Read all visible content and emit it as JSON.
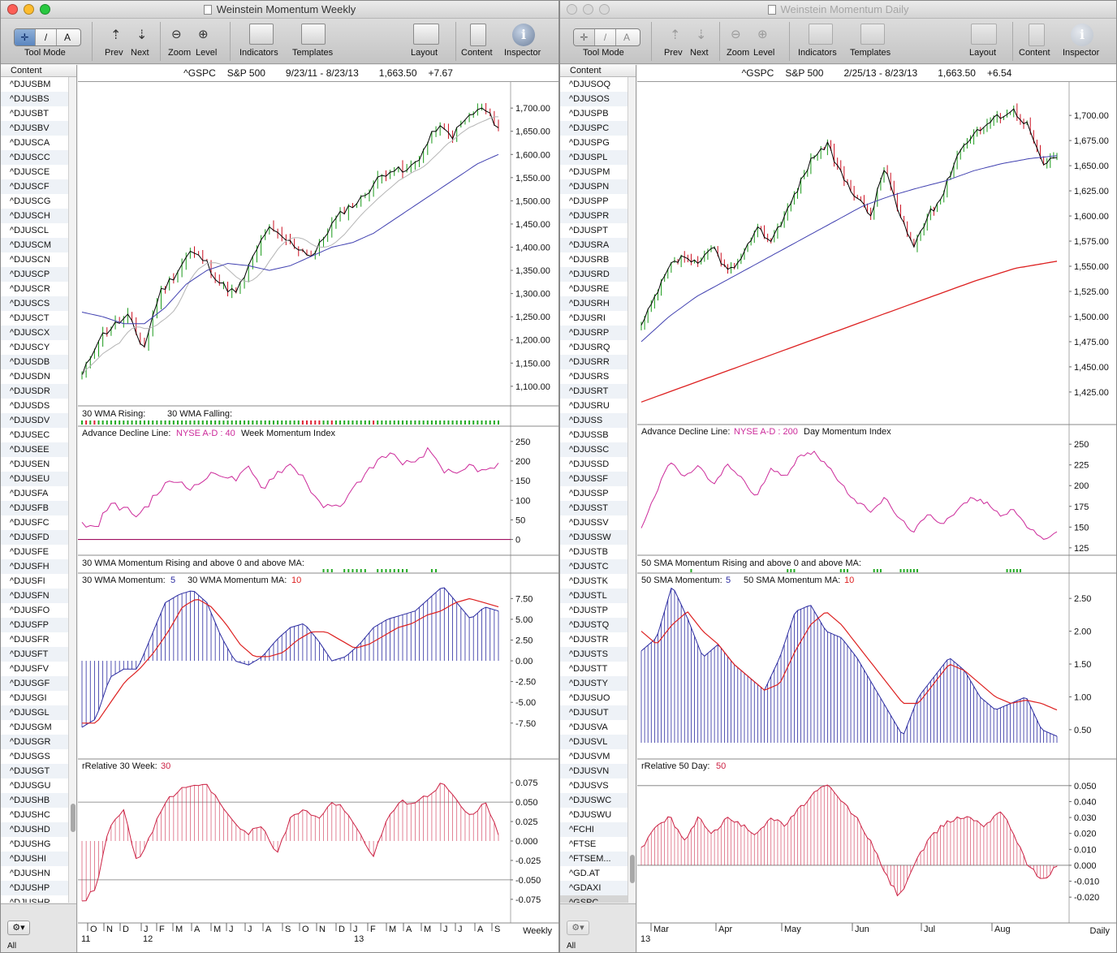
{
  "windows": [
    {
      "id": "weekly",
      "title": "Weinstein Momentum Weekly",
      "active": true,
      "toolbar": {
        "tool_mode": "Tool Mode",
        "prev": "Prev",
        "next": "Next",
        "zoom": "Zoom",
        "level": "Level",
        "indicators": "Indicators",
        "templates": "Templates",
        "layout": "Layout",
        "content": "Content",
        "inspector": "Inspector",
        "tool_glyphs": [
          "✛",
          "/",
          "A"
        ]
      },
      "sidebar": {
        "header": "Content",
        "all_label": "All",
        "selected": "",
        "items": [
          "^DJUSBM",
          "^DJUSBS",
          "^DJUSBT",
          "^DJUSBV",
          "^DJUSCA",
          "^DJUSCC",
          "^DJUSCE",
          "^DJUSCF",
          "^DJUSCG",
          "^DJUSCH",
          "^DJUSCL",
          "^DJUSCM",
          "^DJUSCN",
          "^DJUSCP",
          "^DJUSCR",
          "^DJUSCS",
          "^DJUSCT",
          "^DJUSCX",
          "^DJUSCY",
          "^DJUSDB",
          "^DJUSDN",
          "^DJUSDR",
          "^DJUSDS",
          "^DJUSDV",
          "^DJUSEC",
          "^DJUSEE",
          "^DJUSEN",
          "^DJUSEU",
          "^DJUSFA",
          "^DJUSFB",
          "^DJUSFC",
          "^DJUSFD",
          "^DJUSFE",
          "^DJUSFH",
          "^DJUSFI",
          "^DJUSFN",
          "^DJUSFO",
          "^DJUSFP",
          "^DJUSFR",
          "^DJUSFT",
          "^DJUSFV",
          "^DJUSGF",
          "^DJUSGI",
          "^DJUSGL",
          "^DJUSGM",
          "^DJUSGR",
          "^DJUSGS",
          "^DJUSGT",
          "^DJUSGU",
          "^DJUSHB",
          "^DJUSHC",
          "^DJUSHD",
          "^DJUSHG",
          "^DJUSHI",
          "^DJUSHN",
          "^DJUSHP",
          "^DJUSHR"
        ]
      },
      "chart": {
        "symbol": "^GSPC",
        "name": "S&P 500",
        "range": "9/23/11 - 8/23/13",
        "last": "1,663.50",
        "change": "+7.67",
        "period": "Weekly",
        "panels": {
          "price": {
            "ticks": [
              "1,700.00",
              "1,650.00",
              "1,600.00",
              "1,550.00",
              "1,500.00",
              "1,450.00",
              "1,400.00",
              "1,350.00",
              "1,300.00",
              "1,250.00",
              "1,200.00",
              "1,150.00",
              "1,100.00"
            ]
          },
          "rising_falling": {
            "label_a": "30 WMA Rising:",
            "label_b": "30 WMA Falling:"
          },
          "adl": {
            "label": "Advance Decline Line:",
            "series": "NYSE A-D : 40",
            "extra": "Week Momentum Index",
            "ticks": [
              "250",
              "200",
              "150",
              "100",
              "50",
              "0"
            ]
          },
          "mom_rising": {
            "label": "30 WMA Momentum Rising and above 0 and above MA:"
          },
          "momentum": {
            "label_a": "30 WMA Momentum:",
            "value_a": "5",
            "label_b": "30 WMA Momentum MA:",
            "value_b": "10",
            "ticks": [
              "7.50",
              "5.00",
              "2.50",
              "0.00",
              "-2.50",
              "-5.00",
              "-7.50"
            ]
          },
          "relative": {
            "label": "rRelative 30 Week:",
            "value": "30",
            "ticks": [
              "0.075",
              "0.050",
              "0.025",
              "0.000",
              "-0.025",
              "-0.050",
              "-0.075"
            ]
          }
        },
        "x_months": [
          "O",
          "N",
          "D",
          "J",
          "F",
          "M",
          "A",
          "M",
          "J",
          "J",
          "A",
          "S",
          "O",
          "N",
          "D",
          "J",
          "F",
          "M",
          "A",
          "M",
          "J",
          "J",
          "A",
          "S"
        ],
        "x_years": [
          "11",
          "12",
          "13"
        ]
      }
    },
    {
      "id": "daily",
      "title": "Weinstein Momentum Daily",
      "active": false,
      "toolbar": {
        "tool_mode": "Tool Mode",
        "prev": "Prev",
        "next": "Next",
        "zoom": "Zoom",
        "level": "Level",
        "indicators": "Indicators",
        "templates": "Templates",
        "layout": "Layout",
        "content": "Content",
        "inspector": "Inspector",
        "tool_glyphs": [
          "✛",
          "/",
          "A"
        ]
      },
      "sidebar": {
        "header": "Content",
        "all_label": "All",
        "selected": "^GSPC",
        "items": [
          "^DJUSOQ",
          "^DJUSOS",
          "^DJUSPB",
          "^DJUSPC",
          "^DJUSPG",
          "^DJUSPL",
          "^DJUSPM",
          "^DJUSPN",
          "^DJUSPP",
          "^DJUSPR",
          "^DJUSPT",
          "^DJUSRA",
          "^DJUSRB",
          "^DJUSRD",
          "^DJUSRE",
          "^DJUSRH",
          "^DJUSRI",
          "^DJUSRP",
          "^DJUSRQ",
          "^DJUSRR",
          "^DJUSRS",
          "^DJUSRT",
          "^DJUSRU",
          "^DJUSS",
          "^DJUSSB",
          "^DJUSSC",
          "^DJUSSD",
          "^DJUSSF",
          "^DJUSSP",
          "^DJUSST",
          "^DJUSSV",
          "^DJUSSW",
          "^DJUSTB",
          "^DJUSTC",
          "^DJUSTK",
          "^DJUSTL",
          "^DJUSTP",
          "^DJUSTQ",
          "^DJUSTR",
          "^DJUSTS",
          "^DJUSTT",
          "^DJUSTY",
          "^DJUSUO",
          "^DJUSUT",
          "^DJUSVA",
          "^DJUSVL",
          "^DJUSVM",
          "^DJUSVN",
          "^DJUSVS",
          "^DJUSWC",
          "^DJUSWU",
          "^FCHI",
          "^FTSE",
          "^FTSEM...",
          "^GD.AT",
          "^GDAXI",
          "^GSPC"
        ]
      },
      "chart": {
        "symbol": "^GSPC",
        "name": "S&P 500",
        "range": "2/25/13 - 8/23/13",
        "last": "1,663.50",
        "change": "+6.54",
        "period": "Daily",
        "panels": {
          "price": {
            "ticks": [
              "1,700.00",
              "1,675.00",
              "1,650.00",
              "1,625.00",
              "1,600.00",
              "1,575.00",
              "1,550.00",
              "1,525.00",
              "1,500.00",
              "1,475.00",
              "1,450.00",
              "1,425.00"
            ]
          },
          "adl": {
            "label": "Advance Decline Line:",
            "series": "NYSE A-D : 200",
            "extra": "Day Momentum Index",
            "ticks": [
              "250",
              "225",
              "200",
              "175",
              "150",
              "125"
            ]
          },
          "mom_rising": {
            "label": "50 SMA Momentum Rising and above 0 and above MA:"
          },
          "momentum": {
            "label_a": "50 SMA Momentum:",
            "value_a": "5",
            "label_b": "50 SMA Momentum MA:",
            "value_b": "10",
            "ticks": [
              "2.50",
              "2.00",
              "1.50",
              "1.00",
              "0.50"
            ]
          },
          "relative": {
            "label": "rRelative 50 Day:",
            "value": "50",
            "ticks": [
              "0.050",
              "0.040",
              "0.030",
              "0.020",
              "0.010",
              "0.000",
              "-0.010",
              "-0.020"
            ]
          }
        },
        "x_months": [
          "Mar",
          "Apr",
          "May",
          "Jun",
          "Jul",
          "Aug"
        ],
        "x_years": [
          "13"
        ]
      }
    }
  ],
  "colors": {
    "price_line": "#000000",
    "up_bar": "#1a9a1a",
    "down_bar": "#cc1122",
    "ma_fast": "#b5b5b5",
    "ma_slow": "#4040b0",
    "ma_long": "#dd2020",
    "adl": "#cc2a9a",
    "momentum": "#2a2aa0",
    "momentum_ma": "#dd2020",
    "relative": "#cc2244",
    "rising": "#22aa22",
    "falling": "#dd2233"
  }
}
